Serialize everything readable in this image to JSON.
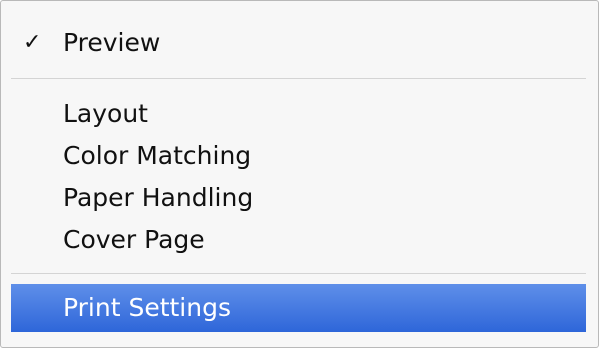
{
  "menu": {
    "checked_item": {
      "check_mark": "✓",
      "label": "Preview"
    },
    "items": [
      {
        "label": "Layout"
      },
      {
        "label": "Color Matching"
      },
      {
        "label": "Paper Handling"
      },
      {
        "label": "Cover Page"
      }
    ],
    "selected_item": {
      "label": "Print Settings"
    },
    "colors": {
      "highlight": "#3a72de",
      "highlight_text": "#ffffff",
      "background": "#f7f7f7",
      "separator": "#d4d4d4"
    }
  }
}
